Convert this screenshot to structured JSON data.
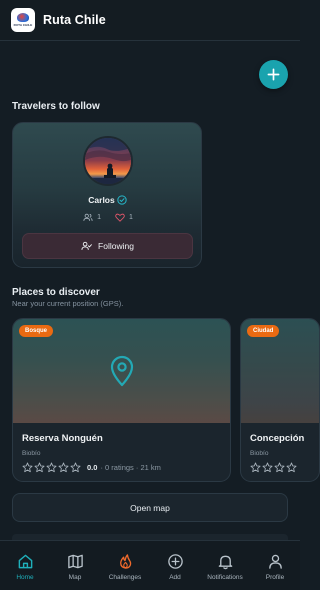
{
  "app": {
    "title": "Ruta Chile",
    "logo_text": "RUTA CHILE"
  },
  "travelers": {
    "section_title": "Travelers to follow",
    "items": [
      {
        "name": "Carlos",
        "verified": true,
        "followers": "1",
        "likes": "1",
        "button_label": "Following"
      }
    ]
  },
  "places": {
    "section_title": "Places to discover",
    "subtitle": "Near your current position (GPS).",
    "items": [
      {
        "tag": "Bosque",
        "name": "Reserva Nonguén",
        "region": "Biobío",
        "rating": "0.0",
        "meta": "· 0 ratings · 21 km"
      },
      {
        "tag": "Ciudad",
        "name": "Concepción",
        "region": "Biobío"
      }
    ],
    "open_map_label": "Open map"
  },
  "nav": {
    "active": "Home",
    "items": [
      {
        "label": "Home",
        "icon": "home-icon"
      },
      {
        "label": "Map",
        "icon": "map-icon"
      },
      {
        "label": "Challenges",
        "icon": "flame-icon"
      },
      {
        "label": "Add",
        "icon": "plus-circle-icon"
      },
      {
        "label": "Notifications",
        "icon": "bell-icon"
      },
      {
        "label": "Profile",
        "icon": "user-icon"
      }
    ]
  },
  "colors": {
    "background": "#141d24",
    "accent": "#1aa3ae",
    "tag": "#ea6a12",
    "like": "#e0566a"
  }
}
